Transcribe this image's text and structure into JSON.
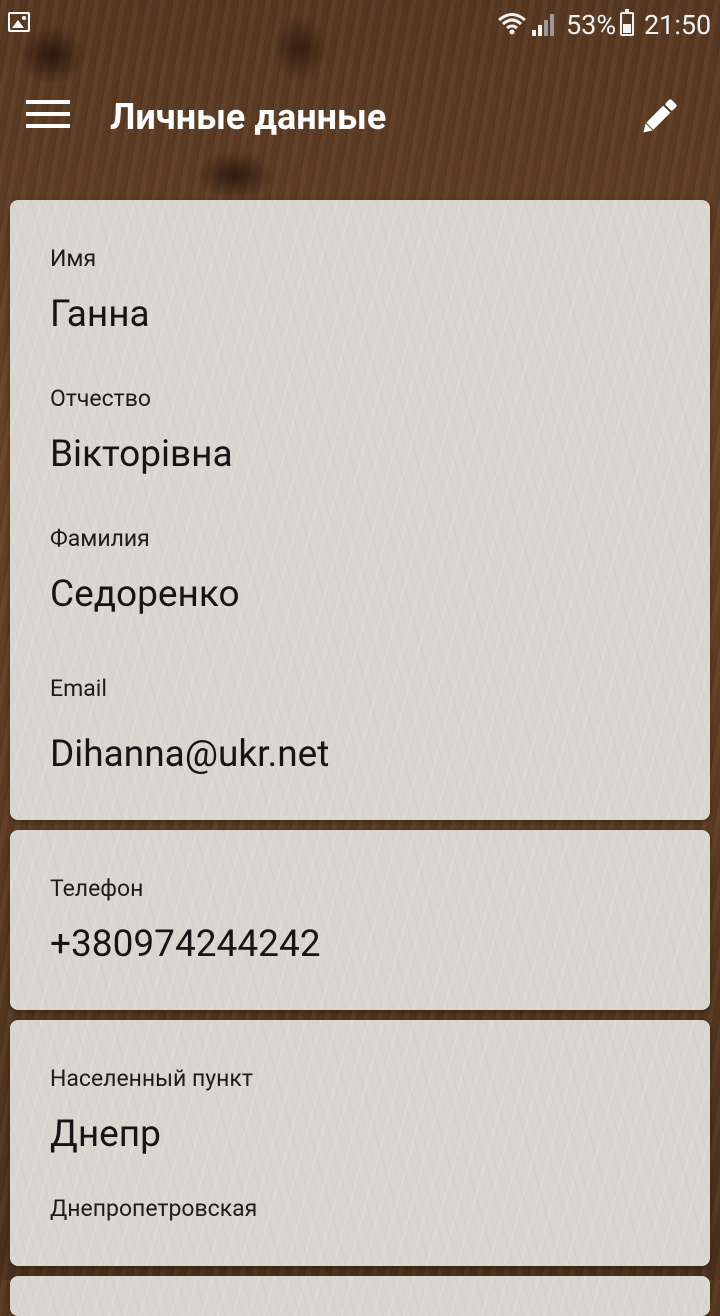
{
  "status_bar": {
    "battery_percent": "53%",
    "time": "21:50",
    "icons": [
      "gallery-icon",
      "wifi-icon",
      "signal-icon",
      "battery-icon"
    ]
  },
  "app_bar": {
    "title": "Личные данные",
    "menu_icon": "menu-icon",
    "edit_icon": "pencil-icon"
  },
  "personal": {
    "first_name_label": "Имя",
    "first_name": "Ганна",
    "patronymic_label": "Отчество",
    "patronymic": "Вікторівна",
    "last_name_label": "Фамилия",
    "last_name": "Седоренко",
    "email_label": "Email",
    "email": "Dihanna@ukr.net"
  },
  "contact": {
    "phone_label": "Телефон",
    "phone": "+380974244242"
  },
  "location": {
    "city_label": "Населенный пункт",
    "city": "Днепр",
    "region": "Днепропетровская"
  }
}
